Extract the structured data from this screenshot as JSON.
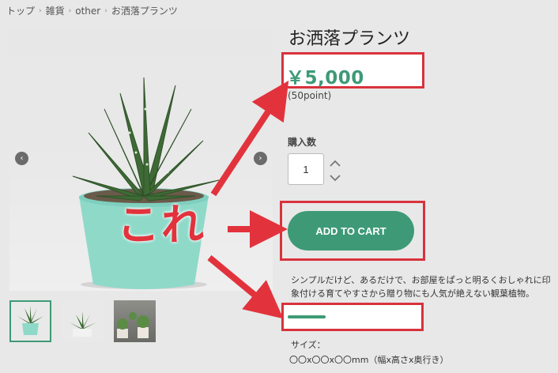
{
  "breadcrumb": {
    "items": [
      "トップ",
      "雑貨",
      "other",
      "お洒落プランツ"
    ],
    "separator": "›"
  },
  "gallery": {
    "prev_icon": "‹",
    "next_icon": "›"
  },
  "product": {
    "title": "お洒落プランツ",
    "price": "￥5,000",
    "points": "(50point)",
    "quantity_label": "購入数",
    "quantity_value": "1",
    "add_to_cart_label": "ADD TO CART",
    "description": "シンプルだけど、あるだけで、お部屋をぱっと明るくおしゃれに印象付ける育てやすさから贈り物にも人気が絶えない観葉植物。",
    "size_label": "サイズ：",
    "size_value": "〇〇x〇〇x〇〇mm（幅x高さx奥行き）"
  },
  "annotation": {
    "overlay_text": "これ",
    "highlight_color": "#d9323c"
  },
  "colors": {
    "accent": "#3e9a76",
    "annotation_red": "#e2333d"
  }
}
